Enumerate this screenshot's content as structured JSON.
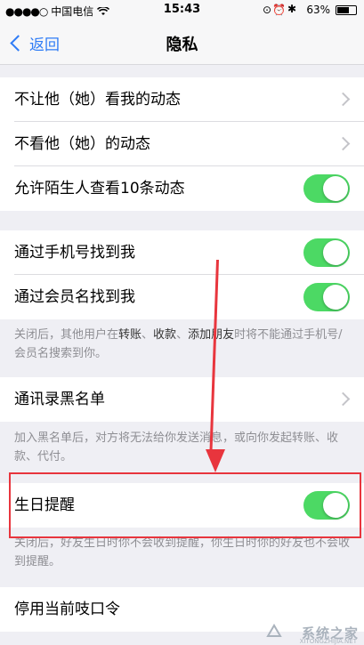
{
  "status_bar": {
    "carrier": "中国电信",
    "time": "15:43",
    "battery": "63%"
  },
  "nav": {
    "back_label": "返回",
    "title": "隐私"
  },
  "section1": [
    {
      "label": "不让他（她）看我的动态",
      "control": "chevron"
    },
    {
      "label": "不看他（她）的动态",
      "control": "chevron"
    },
    {
      "label": "允许陌生人查看10条动态",
      "control": "toggle",
      "on": true
    }
  ],
  "section2": [
    {
      "label": "通过手机号找到我",
      "control": "toggle",
      "on": true
    },
    {
      "label": "通过会员名找到我",
      "control": "toggle",
      "on": true
    }
  ],
  "footnote2": {
    "prefix": "关闭后，其他用户在",
    "kw1": "转账",
    "sep1": "、",
    "kw2": "收款",
    "sep2": "、",
    "kw3": "添加朋友",
    "suffix": "时将不能通过手机号/会员名搜索到你。"
  },
  "section3": [
    {
      "label": "通讯录黑名单",
      "control": "chevron"
    }
  ],
  "footnote3": "加入黑名单后，对方将无法给你发送消息，或向你发起转账、收款、代付。",
  "section4": [
    {
      "label": "生日提醒",
      "control": "toggle",
      "on": true
    }
  ],
  "footnote4": "关闭后，好友生日时你不会收到提醒，你生日时你的好友也不会收到提醒。",
  "section5": [
    {
      "label": "停用当前吱口令",
      "control": "none"
    }
  ],
  "watermark": {
    "text": "系统之家",
    "sub": "XITONGZHIJIA.NET"
  },
  "colors": {
    "toggle_on": "#4cd964",
    "accent": "#2f7cf6",
    "annotation": "#e8353d"
  }
}
